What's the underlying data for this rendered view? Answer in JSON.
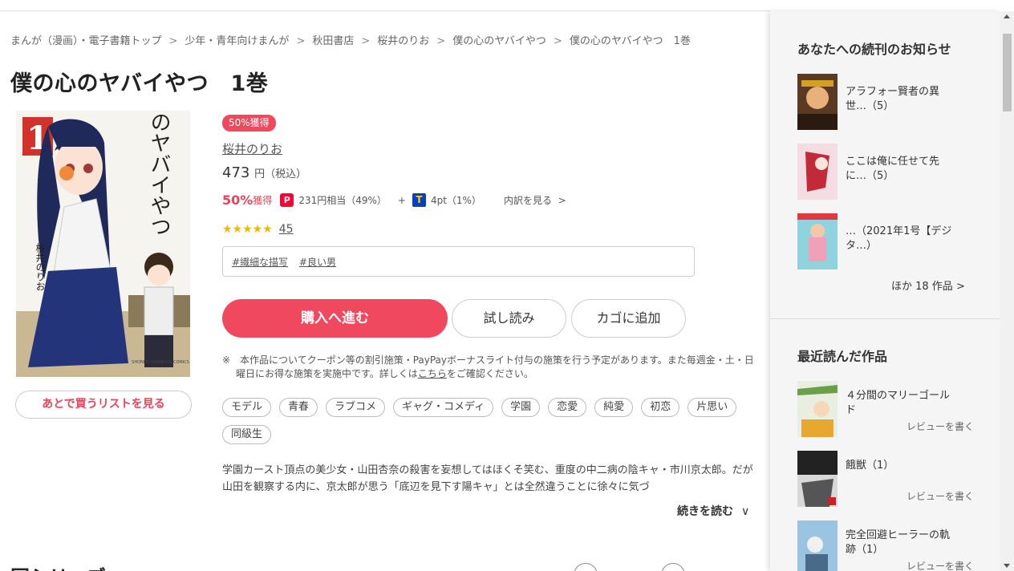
{
  "breadcrumb": [
    "まんが（漫画）・電子書籍トップ",
    "少年・青年向けまんが",
    "秋田書店",
    "桜井のりお",
    "僕の心のヤバイやつ",
    "僕の心のヤバイやつ　1巻"
  ],
  "breadcrumb_sep": ">",
  "title": "僕の心のヤバイやつ　1巻",
  "cover": {
    "volume": "1",
    "title": "僕の心のヤバイやつ",
    "author": "桜井のりお",
    "label": "SHONEN CHAMPION COMICS"
  },
  "badge": "50%獲得",
  "author": "桜井のりお",
  "price": {
    "amount": "473",
    "unit": "円（税込）"
  },
  "points": {
    "percent": "50%",
    "get_label": "獲得",
    "paypay_icon": "paypay-icon",
    "paypay_text": "231円相当（49%）",
    "plus": "+",
    "tpoint_icon": "tpoint-icon",
    "tpoint_text": "4pt（1%）",
    "breakdown": "内訳を見る",
    "breakdown_chev": ">"
  },
  "rating": {
    "stars": 4.5,
    "stars_glyph": "★★★★★",
    "count": "45"
  },
  "tags": [
    "#繊細な描写",
    "#良い男"
  ],
  "buttons": {
    "buy": "購入へ進む",
    "trial": "試し読み",
    "cart": "カゴに追加",
    "later": "あとで買うリストを見る"
  },
  "note": {
    "text_before": "※　本作品についてクーポン等の割引施策・PayPayボーナスライト付与の施策を行う予定があります。また毎週金・土・日曜日にお得な施策を実施中です。詳しくは",
    "link": "こちら",
    "text_after": "をご確認ください。"
  },
  "genres": [
    "モデル",
    "青春",
    "ラブコメ",
    "ギャグ・コメディ",
    "学園",
    "恋愛",
    "純愛",
    "初恋",
    "片思い",
    "同級生"
  ],
  "description": "学園カースト頂点の美少女・山田杏奈の殺害を妄想してはほくそ笑む、重度の中二病の陰キャ・市川京太郎。だが山田を観察する内に、京太郎が思う「底辺を見下す陽キャ」とは全然違うことに徐々に気づ",
  "read_more": {
    "label": "続きを読む",
    "chev": "∨"
  },
  "series_heading": "同シリーズ",
  "sidebar": {
    "notify_heading": "あなたへの続刊のお知らせ",
    "notify_items": [
      {
        "title": "アラフォー賢者の異世…（5）"
      },
      {
        "title": "ここは俺に任せて先に…（5）"
      },
      {
        "title": "…（2021年1号【デジタ…）"
      }
    ],
    "more": "ほか 18 作品 >",
    "recent_heading": "最近読んだ作品",
    "recent_items": [
      {
        "title": "４分間のマリーゴールド",
        "review": "レビューを書く"
      },
      {
        "title": "餓獣（1）",
        "review": "レビューを書く"
      },
      {
        "title": "完全回避ヒーラーの軌跡（1）",
        "review": "レビューを書く"
      }
    ]
  }
}
